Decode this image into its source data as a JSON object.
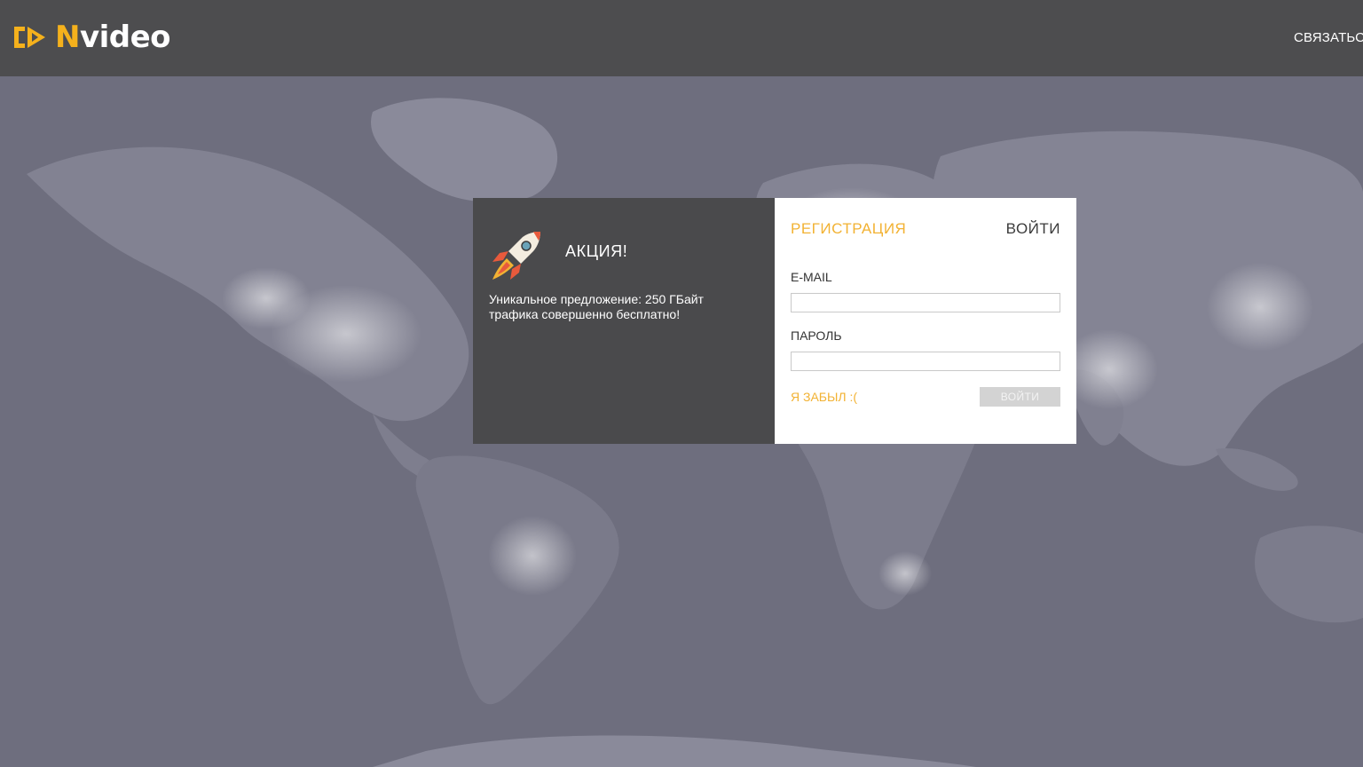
{
  "header": {
    "logo": {
      "part1": "CDN",
      "part2": "video"
    },
    "contact_label": "СВЯЗАТЬСЯ"
  },
  "promo": {
    "icon": "rocket-icon",
    "title": "АКЦИЯ!",
    "text": "Уникальное предложение: 250 ГБайт трафика совершенно бесплатно!"
  },
  "auth": {
    "tabs": {
      "register": "РЕГИСТРАЦИЯ",
      "login": "ВОЙТИ"
    },
    "email": {
      "label": "E-MAIL",
      "value": "",
      "placeholder": ""
    },
    "password": {
      "label": "ПАРОЛЬ",
      "value": "",
      "placeholder": ""
    },
    "forgot_label": "Я ЗАБЫЛ :(",
    "submit_label": "ВОЙТИ"
  },
  "colors": {
    "header_bg": "#4d4d4f",
    "accent": "#f2b233",
    "promo_bg": "#4a4a4c",
    "map_bg": "#6e6e7e"
  }
}
